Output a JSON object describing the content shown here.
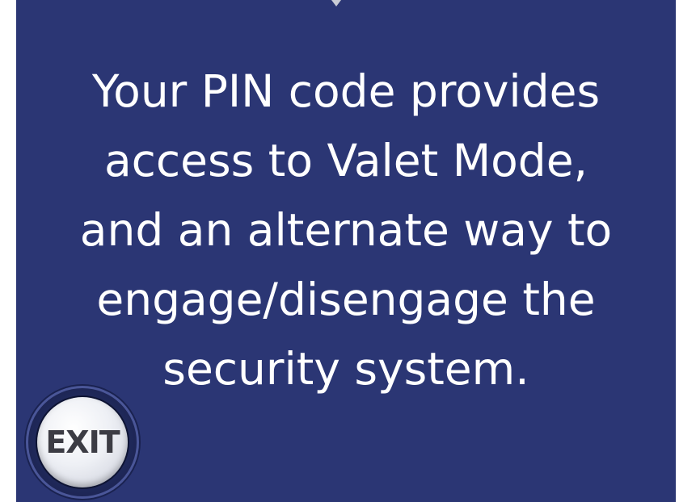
{
  "screen": {
    "message": "Your PIN code provides\naccess to Valet Mode,\nand an alternate way to\nengage/disengage the\nsecurity system.",
    "exit_label": "EXIT",
    "background_color": "#2b3674"
  }
}
